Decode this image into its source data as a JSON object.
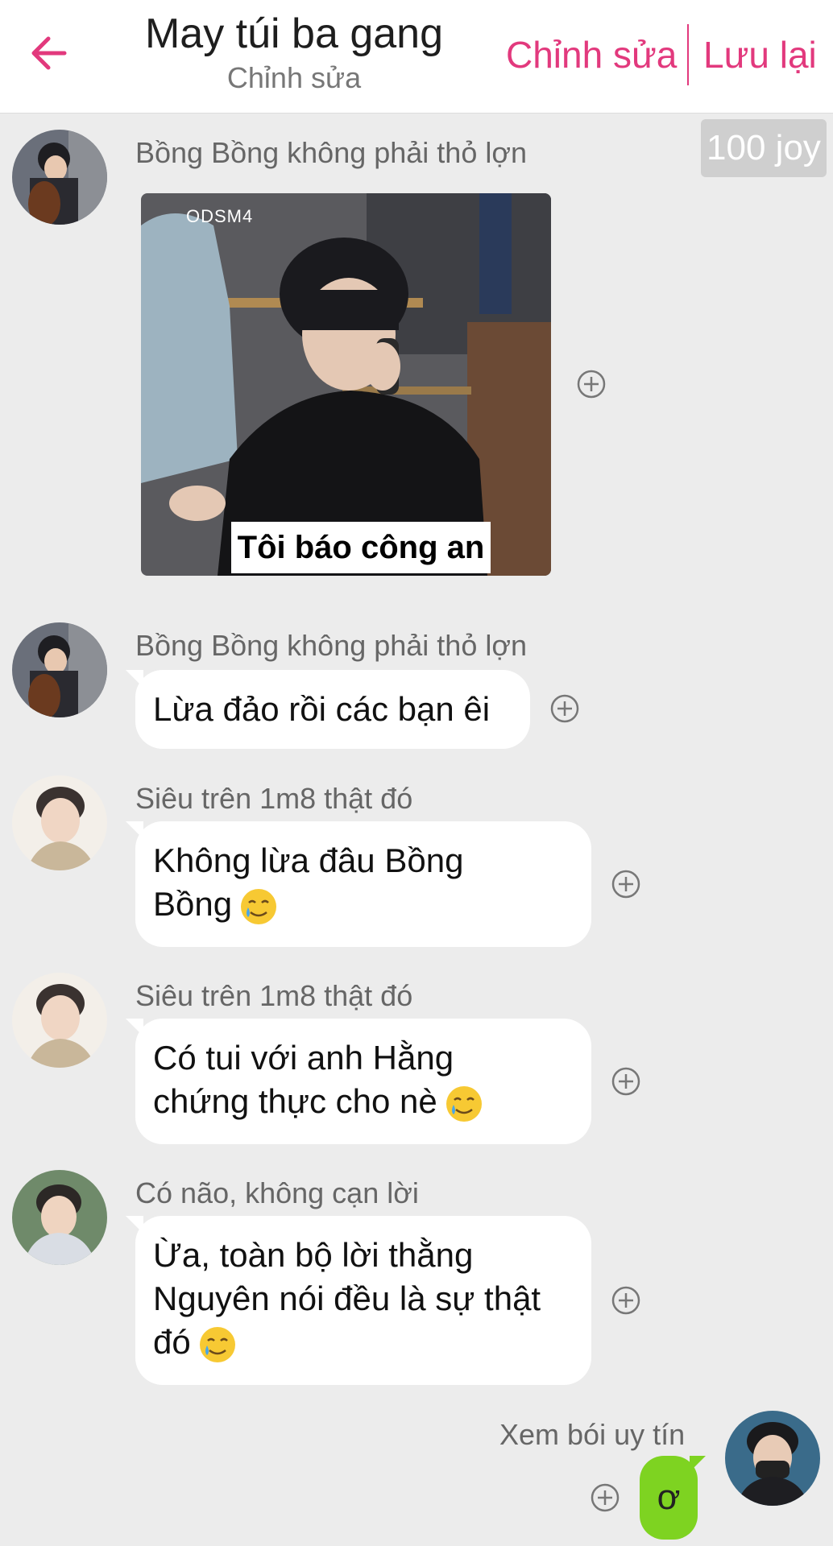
{
  "header": {
    "title": "May túi ba gang",
    "subtitle": "Chỉnh sửa",
    "edit_label": "Chỉnh sửa",
    "save_label": "Lưu lại",
    "accent_color": "#e2397d"
  },
  "joy_badge": "100 joy",
  "messages": [
    {
      "sender": "Bồng Bồng không phải thỏ lợn",
      "type": "image",
      "caption": "Tôi báo công an",
      "watermark": "ODSM4"
    },
    {
      "sender": "Bồng Bồng không phải thỏ lợn",
      "text": "Lừa đảo rồi các bạn êi"
    },
    {
      "sender": "Siêu trên 1m8 thật đó",
      "lines": [
        "Không lừa đâu Bồng",
        "Bồng"
      ]
    },
    {
      "sender": "Siêu trên 1m8 thật đó",
      "lines": [
        "Có tui với anh Hằng",
        "chứng thực cho nè"
      ]
    },
    {
      "sender": "Có não, không cạn lời",
      "lines": [
        "Ừa, toàn bộ lời thằng",
        "Nguyên nói đều là sự thật",
        "đó"
      ]
    },
    {
      "sender": "Xem bói uy tín",
      "text": "ơ",
      "bubble_color": "#7ed321"
    }
  ]
}
